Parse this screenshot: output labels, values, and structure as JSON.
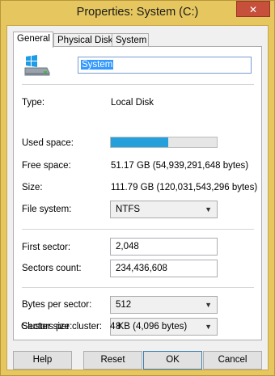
{
  "window": {
    "title": "Properties: System (C:)",
    "close_glyph": "✕"
  },
  "tabs": [
    {
      "label": "General",
      "active": true
    },
    {
      "label": "Physical Disk",
      "active": false
    },
    {
      "label": "System",
      "active": false
    }
  ],
  "drive": {
    "icon": "drive-icon",
    "name": "System"
  },
  "rows": {
    "type_label": "Type:",
    "type_value": "Local Disk",
    "used_label": "Used space:",
    "used_fraction": 0.54,
    "free_label": "Free space:",
    "free_value": "51.17 GB (54,939,291,648 bytes)",
    "size_label": "Size:",
    "size_value": "111.79 GB (120,031,543,296 bytes)",
    "fs_label": "File system:",
    "fs_value": "NTFS",
    "first_sector_label": "First sector:",
    "first_sector_value": "2,048",
    "sectors_count_label": "Sectors count:",
    "sectors_count_value": "234,436,608",
    "bps_label": "Bytes per sector:",
    "bps_value": "512",
    "spc_label": "Sectors per cluster:",
    "spc_value": "8",
    "cluster_label": "Cluster size:",
    "cluster_value": "4 KB (4,096 bytes)"
  },
  "buttons": {
    "help": "Help",
    "reset": "Reset",
    "ok": "OK",
    "cancel": "Cancel"
  },
  "colors": {
    "title_bar": "#e5c65f",
    "progress": "#26a0da",
    "close": "#c7503d"
  }
}
